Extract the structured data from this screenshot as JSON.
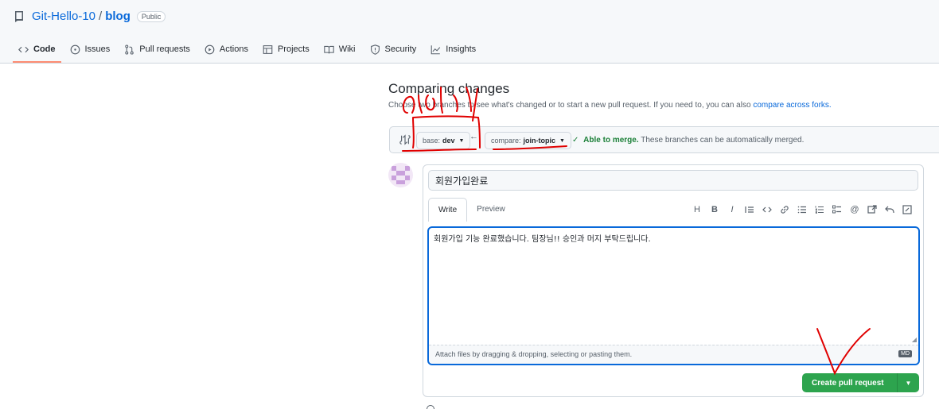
{
  "repo": {
    "owner": "Git-Hello-10",
    "separator": "/",
    "name": "blog",
    "visibility": "Public"
  },
  "nav": {
    "items": [
      {
        "label": "Code",
        "icon": "code-icon",
        "active": true
      },
      {
        "label": "Issues",
        "icon": "issue-icon",
        "active": false
      },
      {
        "label": "Pull requests",
        "icon": "pull-request-icon",
        "active": false
      },
      {
        "label": "Actions",
        "icon": "play-icon",
        "active": false
      },
      {
        "label": "Projects",
        "icon": "table-icon",
        "active": false
      },
      {
        "label": "Wiki",
        "icon": "book-icon",
        "active": false
      },
      {
        "label": "Security",
        "icon": "shield-icon",
        "active": false
      },
      {
        "label": "Insights",
        "icon": "graph-icon",
        "active": false
      }
    ]
  },
  "compare": {
    "title": "Comparing changes",
    "subtitle": "Choose two branches to see what's changed or to start a new pull request. If you need to, you can also",
    "subtitle_link": "compare across forks.",
    "base_prefix": "base:",
    "base_branch": "dev",
    "compare_prefix": "compare:",
    "compare_branch": "join-topic",
    "merge_ok": "Able to merge.",
    "merge_desc": "These branches can be automatically merged."
  },
  "form": {
    "title_value": "회원가입완료",
    "tab_write": "Write",
    "tab_preview": "Preview",
    "body_value": "회원가입 기능 완료했습니다. 팀장님!! 승인과 머지 부탁드립니다.",
    "attach_hint": "Attach files by dragging & dropping, selecting or pasting them.",
    "markdown_badge": "MD",
    "create_label": "Create pull request"
  },
  "colors": {
    "accent": "#0969da",
    "success": "#2da44e",
    "annotation": "#e00000"
  }
}
